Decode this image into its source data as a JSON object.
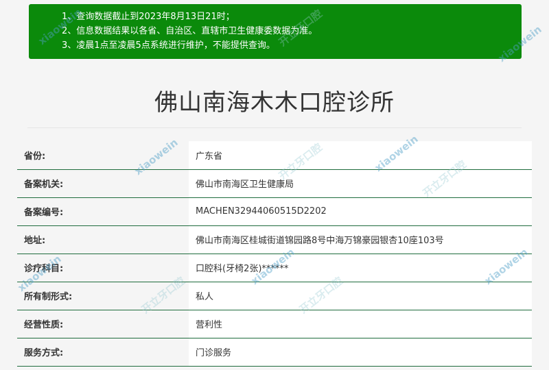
{
  "notice": {
    "lines": [
      "1、查询数据截止到2023年8月13日21时；",
      "2、信息数据结果以各省、自治区、直辖市卫生健康委数据为准。",
      "3、凌晨1点至凌晨5点系统进行维护，不能提供查询。"
    ]
  },
  "page_title": "佛山南海木木口腔诊所",
  "info": [
    {
      "label": "省份:",
      "value": "广东省"
    },
    {
      "label": "备案机关:",
      "value": "佛山市南海区卫生健康局"
    },
    {
      "label": "备案编号:",
      "value": "MACHEN32944060515D2202"
    },
    {
      "label": "地址:",
      "value": "佛山市南海区桂城街道锦园路8号中海万锦豪园银杏10座103号"
    },
    {
      "label": "诊疗科目:",
      "value": "口腔科(牙椅2张)******"
    },
    {
      "label": "所有制形式:",
      "value": "私人"
    },
    {
      "label": "经营性质:",
      "value": "营利性"
    },
    {
      "label": "服务方式:",
      "value": "门诊服务"
    }
  ],
  "watermark": {
    "brand_en": "xiaowein",
    "brand_cn": "开立牙口腔",
    "brand_url": "kaiglie.com"
  },
  "colors": {
    "notice_bg": "#0b8a0b",
    "row_border": "#1e6b3c"
  }
}
